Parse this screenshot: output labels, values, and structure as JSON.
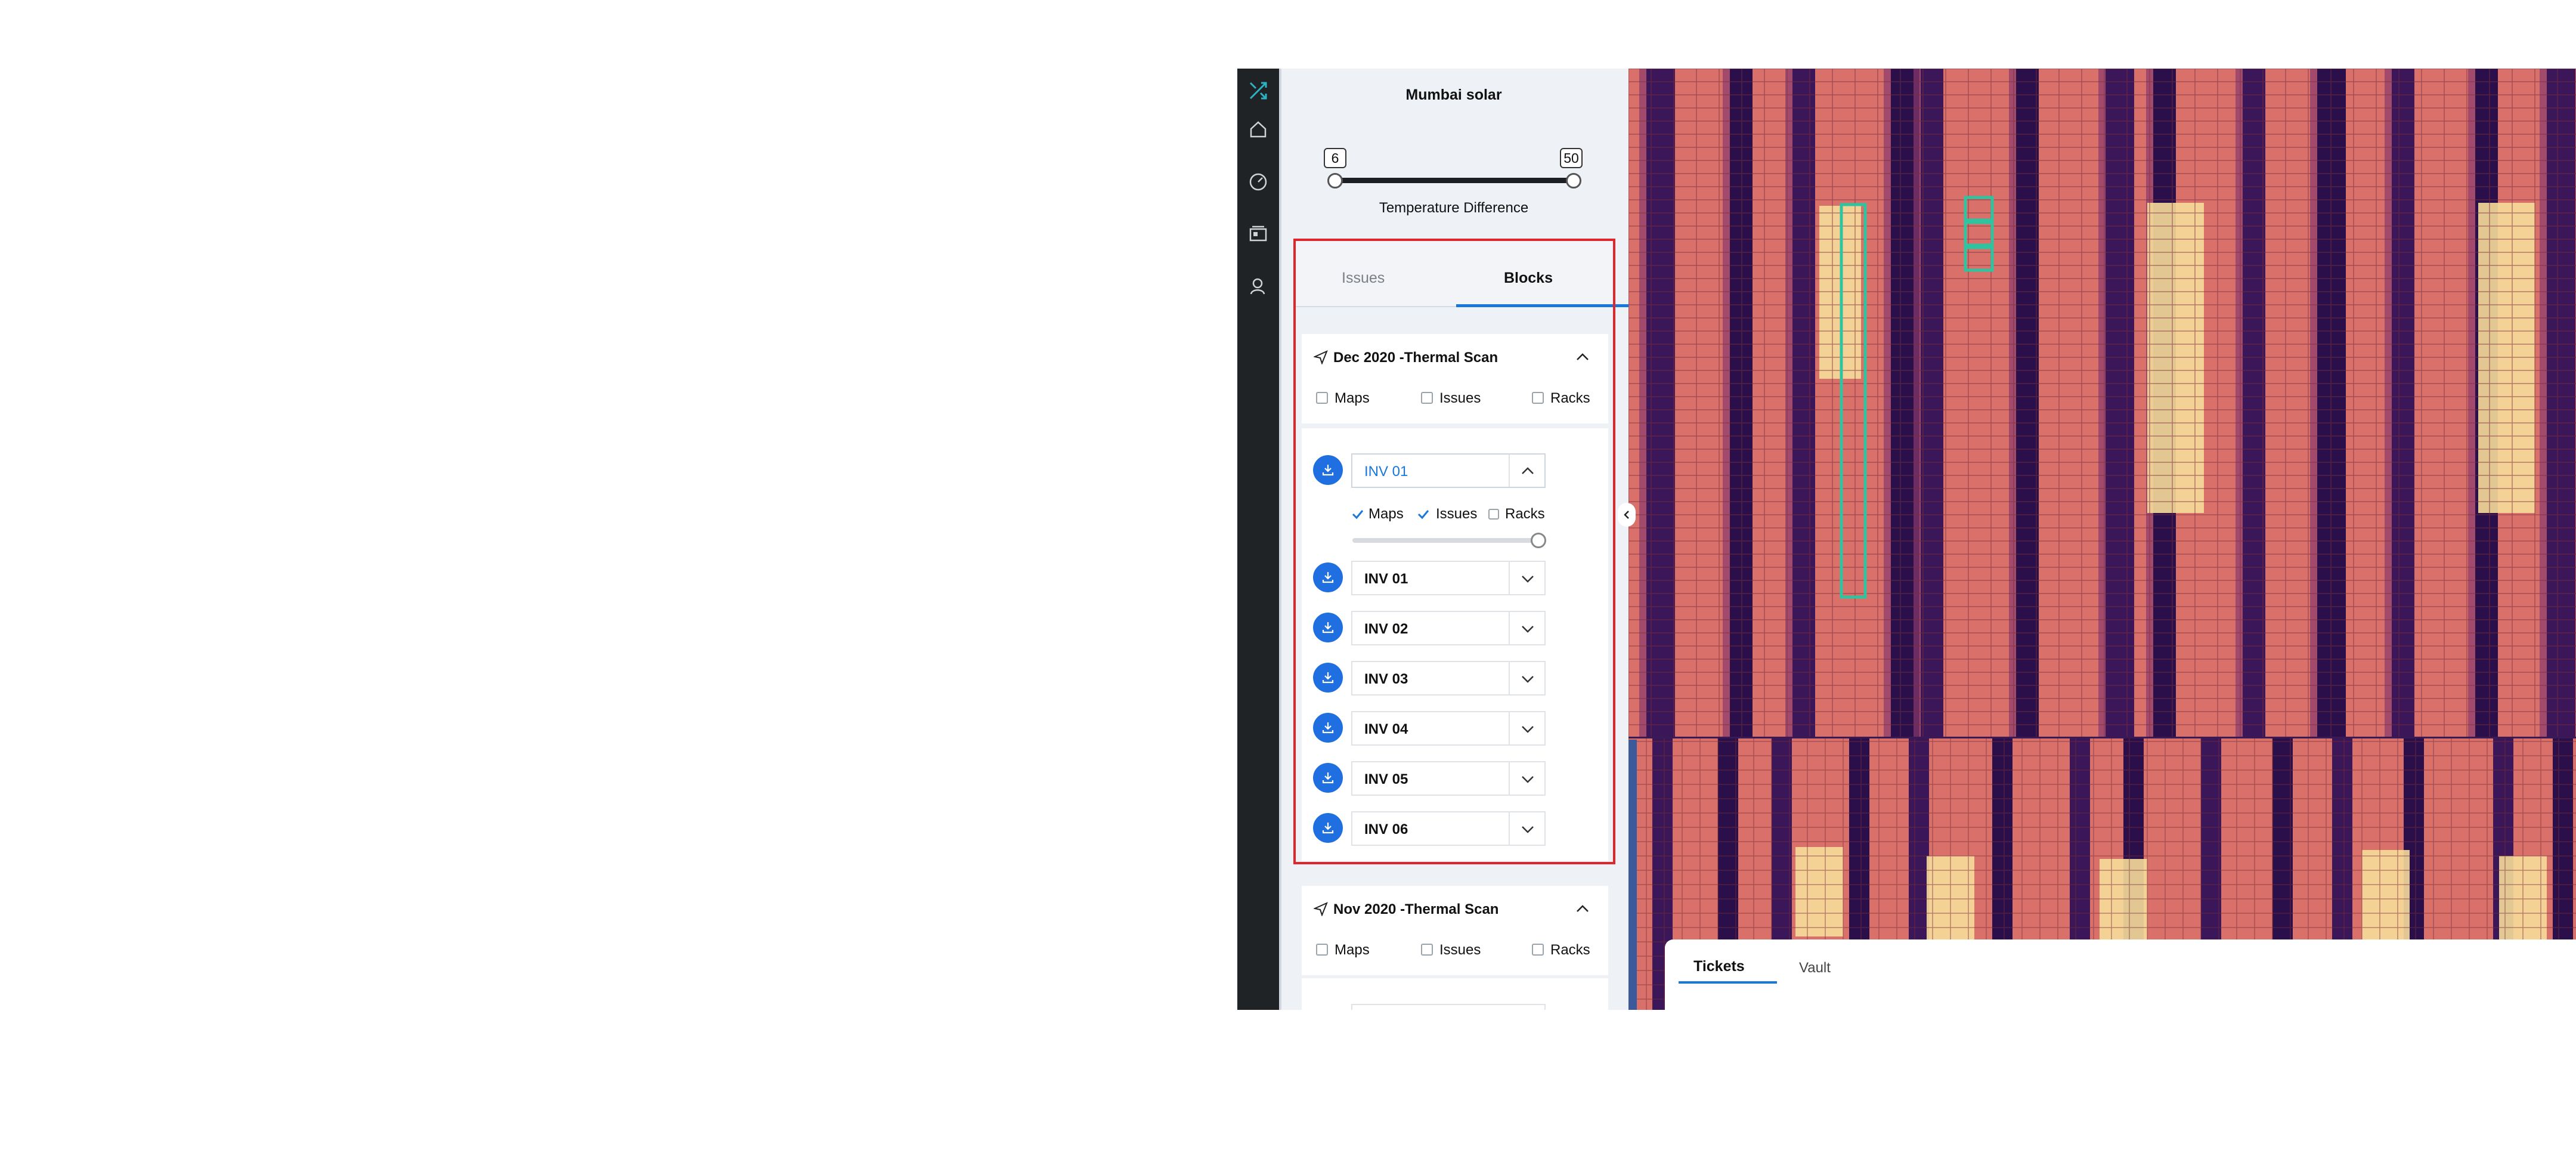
{
  "site_title": "Mumbai solar",
  "temperature_filter": {
    "label": "Temperature Difference",
    "min": "6",
    "max": "50"
  },
  "tabs": [
    {
      "label": "Issues",
      "active": false
    },
    {
      "label": "Blocks",
      "active": true
    }
  ],
  "scans": [
    {
      "title": "Dec 2020 -Thermal Scan",
      "options": [
        "Maps",
        "Issues",
        "Racks"
      ],
      "expanded_block": {
        "name": "INV 01",
        "options": [
          {
            "label": "Maps",
            "checked": true
          },
          {
            "label": "Issues",
            "checked": true
          },
          {
            "label": "Racks",
            "checked": false
          }
        ],
        "opacity": 1.0
      },
      "blocks": [
        "INV 01",
        "INV 02",
        "INV 03",
        "INV 04",
        "INV 05",
        "INV 06"
      ]
    },
    {
      "title": "Nov 2020 -Thermal Scan",
      "options": [
        "Maps",
        "Issues",
        "Racks"
      ]
    }
  ],
  "bottom_tabs": [
    {
      "label": "Tickets",
      "active": true
    },
    {
      "label": "Vault",
      "active": false
    }
  ],
  "colors": {
    "accent": "#1877d8",
    "download_button": "#1f6fe0",
    "highlight_border": "#e0262c",
    "issue_marker": "#2ec4a0",
    "logo": "#2bb3c4"
  },
  "icons": [
    "logo-icon",
    "home-icon",
    "dashboard-icon",
    "gallery-icon",
    "user-icon",
    "send-icon",
    "chevron-up-icon",
    "chevron-down-icon",
    "download-icon",
    "chevron-left-icon"
  ]
}
